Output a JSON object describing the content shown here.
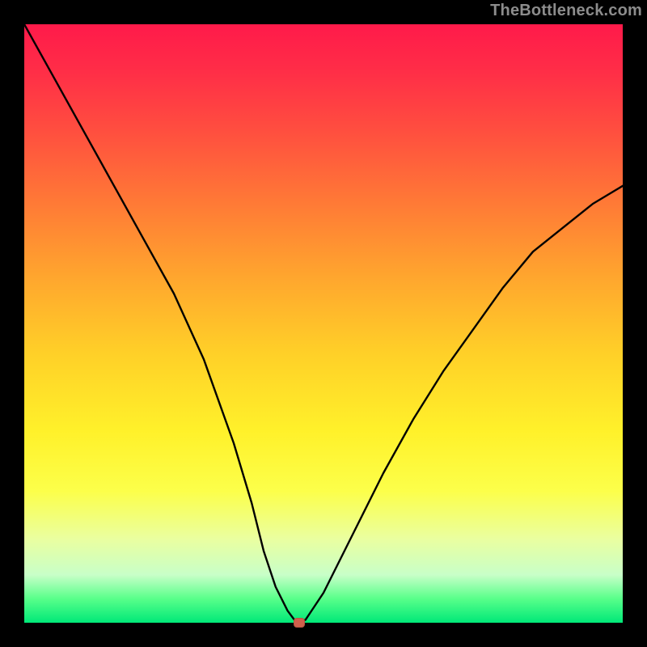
{
  "watermark": "TheBottleneck.com",
  "chart_data": {
    "type": "line",
    "title": "",
    "xlabel": "",
    "ylabel": "",
    "xlim": [
      0,
      100
    ],
    "ylim": [
      0,
      100
    ],
    "series": [
      {
        "name": "bottleneck-curve",
        "x": [
          0,
          5,
          10,
          15,
          20,
          25,
          30,
          35,
          38,
          40,
          42,
          44,
          45.5,
          47,
          50,
          55,
          60,
          65,
          70,
          75,
          80,
          85,
          90,
          95,
          100
        ],
        "y": [
          100,
          91,
          82,
          73,
          64,
          55,
          44,
          30,
          20,
          12,
          6,
          2,
          0,
          0.5,
          5,
          15,
          25,
          34,
          42,
          49,
          56,
          62,
          66,
          70,
          73
        ]
      }
    ],
    "marker": {
      "x": 46,
      "y": 0,
      "color": "#d0604c"
    },
    "background_gradient": {
      "top": "#ff1a4a",
      "bottom": "#00e878"
    }
  }
}
